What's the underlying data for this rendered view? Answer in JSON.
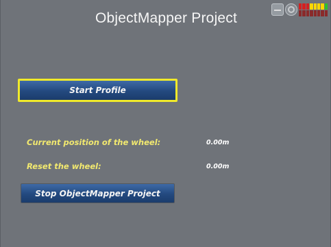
{
  "window": {
    "title": "ObjectMapper Project"
  },
  "status_bar": {
    "icons": [
      "minimize-icon",
      "wheel-status-icon"
    ],
    "signal_meter": {
      "top_row_colors": [
        "#d62020",
        "#d62020",
        "#d62020",
        "#ffd700",
        "#ffd700",
        "#ffd700",
        "#ffd700",
        "#2fbf2f"
      ],
      "bottom_row_colors": [
        "#8a2a2a",
        "#8a2a2a",
        "#8a2a2a",
        "#8a2a2a",
        "#8a2a2a",
        "#8a2a2a",
        "#8a2a2a",
        "#8a2a2a"
      ]
    }
  },
  "actions": {
    "start_label": "Start Profile",
    "stop_label": "Stop ObjectMapper Project"
  },
  "readouts": {
    "current_position_label": "Current position of the wheel:",
    "current_position_value": "0.00m",
    "reset_label": "Reset the wheel:",
    "reset_value": "0.00m"
  },
  "colors": {
    "background": "#6f7379",
    "button_blue": "#23497f",
    "focus_yellow": "#f1ea2a",
    "label_yellow": "#f2e96f"
  }
}
